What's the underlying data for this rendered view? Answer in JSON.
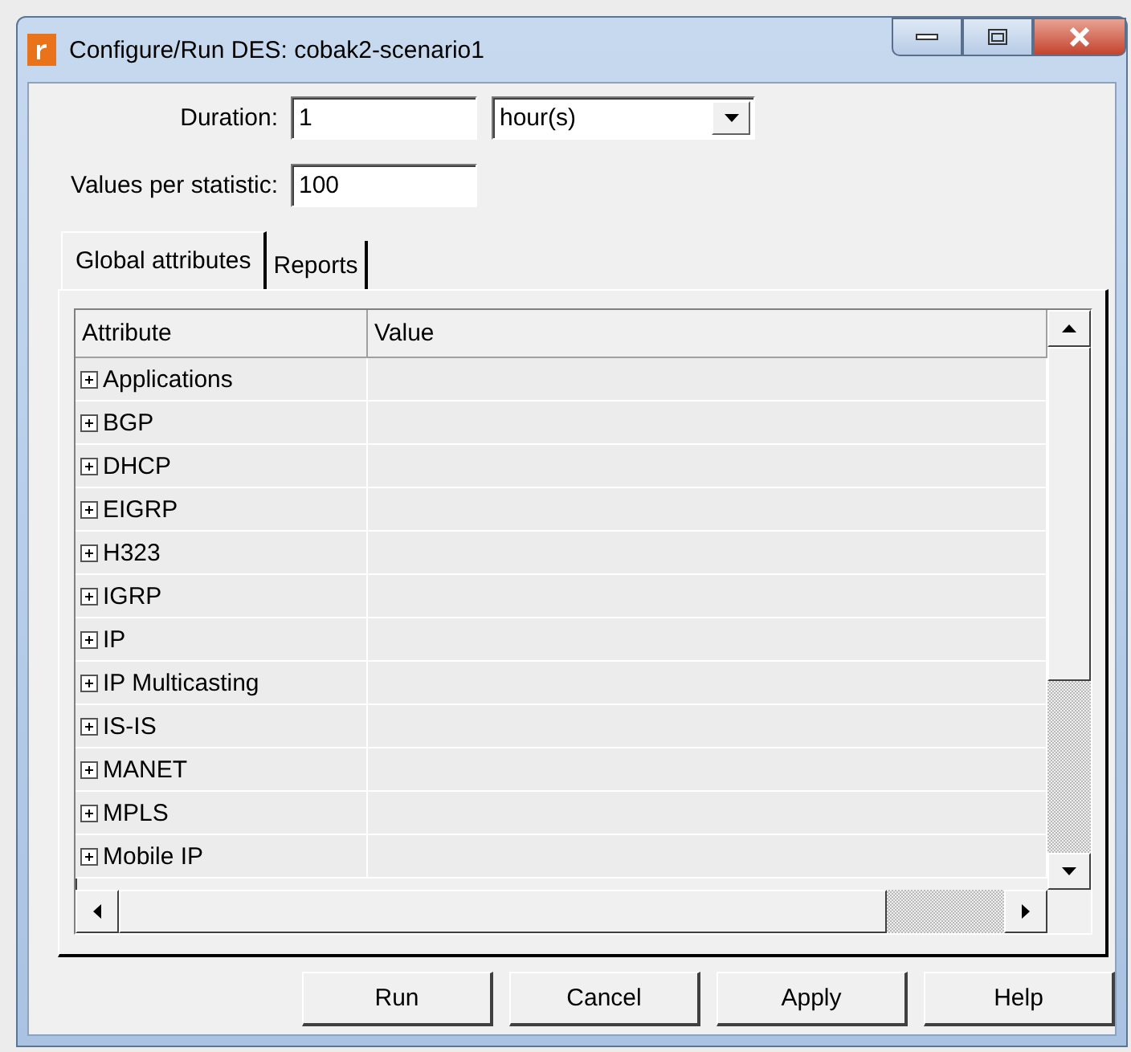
{
  "window": {
    "title": "Configure/Run DES: cobak2-scenario1"
  },
  "duration": {
    "label": "Duration:",
    "value": "1",
    "unit": "hour(s)"
  },
  "values_per_statistic": {
    "label": "Values per statistic:",
    "value": "100"
  },
  "tabs": [
    {
      "label": "Global attributes",
      "selected": true
    },
    {
      "label": "Reports",
      "selected": false
    }
  ],
  "table": {
    "columns": [
      "Attribute",
      "Value"
    ],
    "rows": [
      {
        "attribute": "Applications",
        "expanded": false
      },
      {
        "attribute": "BGP",
        "expanded": false
      },
      {
        "attribute": "DHCP",
        "expanded": false
      },
      {
        "attribute": "EIGRP",
        "expanded": false
      },
      {
        "attribute": "H323",
        "expanded": false
      },
      {
        "attribute": "IGRP",
        "expanded": false
      },
      {
        "attribute": "IP",
        "expanded": false
      },
      {
        "attribute": "IP Multicasting",
        "expanded": false
      },
      {
        "attribute": "IS-IS",
        "expanded": false
      },
      {
        "attribute": "MANET",
        "expanded": false
      },
      {
        "attribute": "MPLS",
        "expanded": false
      },
      {
        "attribute": "Mobile IP",
        "expanded": false
      }
    ]
  },
  "buttons": [
    "Run",
    "Cancel",
    "Apply",
    "Help"
  ]
}
